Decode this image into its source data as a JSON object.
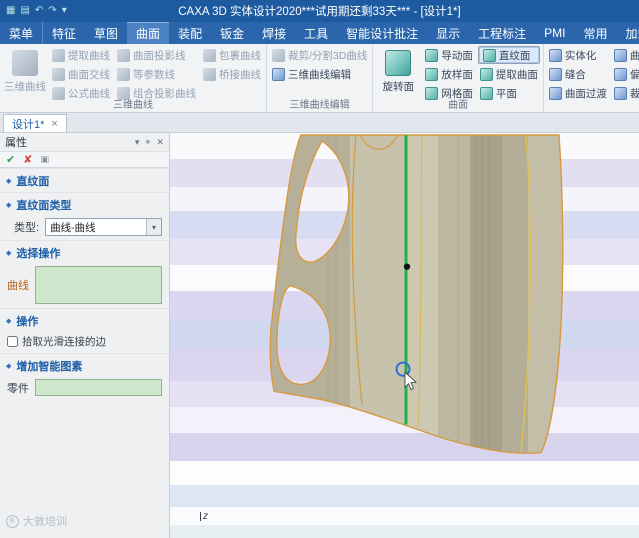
{
  "colors": {
    "titlebar_bg": "#1d5aa0",
    "ribbon_tab_bg": "#2b66ad",
    "accent_blue": "#1d5fa8",
    "highlight_green": "#1fb24a",
    "model_tan": "#c3bda7",
    "edge_orange": "#d79a3c",
    "input_green_bg": "#cfe8cd"
  },
  "titlebar": {
    "title": "CAXA 3D 实体设计2020***试用期还剩33天*** - [设计1*]",
    "quick_access": [
      {
        "name": "app-icon",
        "glyph": "▦"
      },
      {
        "name": "save-icon",
        "glyph": "▤"
      },
      {
        "name": "undo-icon",
        "glyph": "↶"
      },
      {
        "name": "redo-icon",
        "glyph": "↷"
      },
      {
        "name": "customize-icon",
        "glyph": "▾"
      }
    ]
  },
  "menubar": {
    "active_tab": "曲面",
    "tabs": [
      {
        "label": "菜单"
      },
      {
        "label": "特征"
      },
      {
        "label": "草图"
      },
      {
        "label": "曲面"
      },
      {
        "label": "装配"
      },
      {
        "label": "钣金"
      },
      {
        "label": "焊接"
      },
      {
        "label": "工具"
      },
      {
        "label": "智能设计批注"
      },
      {
        "label": "显示"
      },
      {
        "label": "工程标注"
      },
      {
        "label": "PMI"
      },
      {
        "label": "常用"
      },
      {
        "label": "加载"
      }
    ]
  },
  "ribbon": {
    "groups": [
      {
        "label": "三维曲线",
        "big_button": "三维曲线",
        "buttons": [
          "提取曲线",
          "曲面交线",
          "公式曲线",
          "曲面投影线",
          "等参数线",
          "组合投影曲线",
          "包裹曲线",
          "桥接曲线"
        ]
      },
      {
        "label": "三维曲线编辑",
        "buttons": [
          "裁剪/分割3D曲线",
          "三维曲线编辑"
        ]
      },
      {
        "label": "曲面",
        "big_button": "旋转面",
        "buttons": [
          "导动面",
          "放样面",
          "网格面",
          "直纹面",
          "提取曲面",
          "平面"
        ]
      },
      {
        "label": "",
        "buttons": [
          "实体化",
          "缝合",
          "曲面过渡",
          "曲面",
          "偏移",
          "裁剪"
        ]
      }
    ]
  },
  "doc_tabs": [
    {
      "label": "设计1*",
      "close": "×"
    }
  ],
  "sidebar": {
    "title": "属性",
    "header_icons": [
      {
        "name": "panel-menu",
        "glyph": "▾"
      },
      {
        "name": "panel-pin",
        "glyph": "⌖"
      },
      {
        "name": "panel-close",
        "glyph": "✕"
      }
    ],
    "toolbar": {
      "ok": "✔",
      "cancel": "✘",
      "extra": "▣"
    },
    "bullet": "◆",
    "feature_name": "直纹面",
    "type_section": "直纹面类型",
    "type_label": "类型:",
    "type_value": "曲线-曲线",
    "type_arrow": "▾",
    "select_section": "选择操作",
    "curve_label": "曲线",
    "operation_section": "操作",
    "smooth_checkbox_label": "拾取光滑连接的边",
    "smart_section": "增加智能图素",
    "part_label": "零件"
  },
  "viewport": {
    "axis_label": "z",
    "watermark_badge": "K",
    "watermark_text": "大敦培训"
  }
}
